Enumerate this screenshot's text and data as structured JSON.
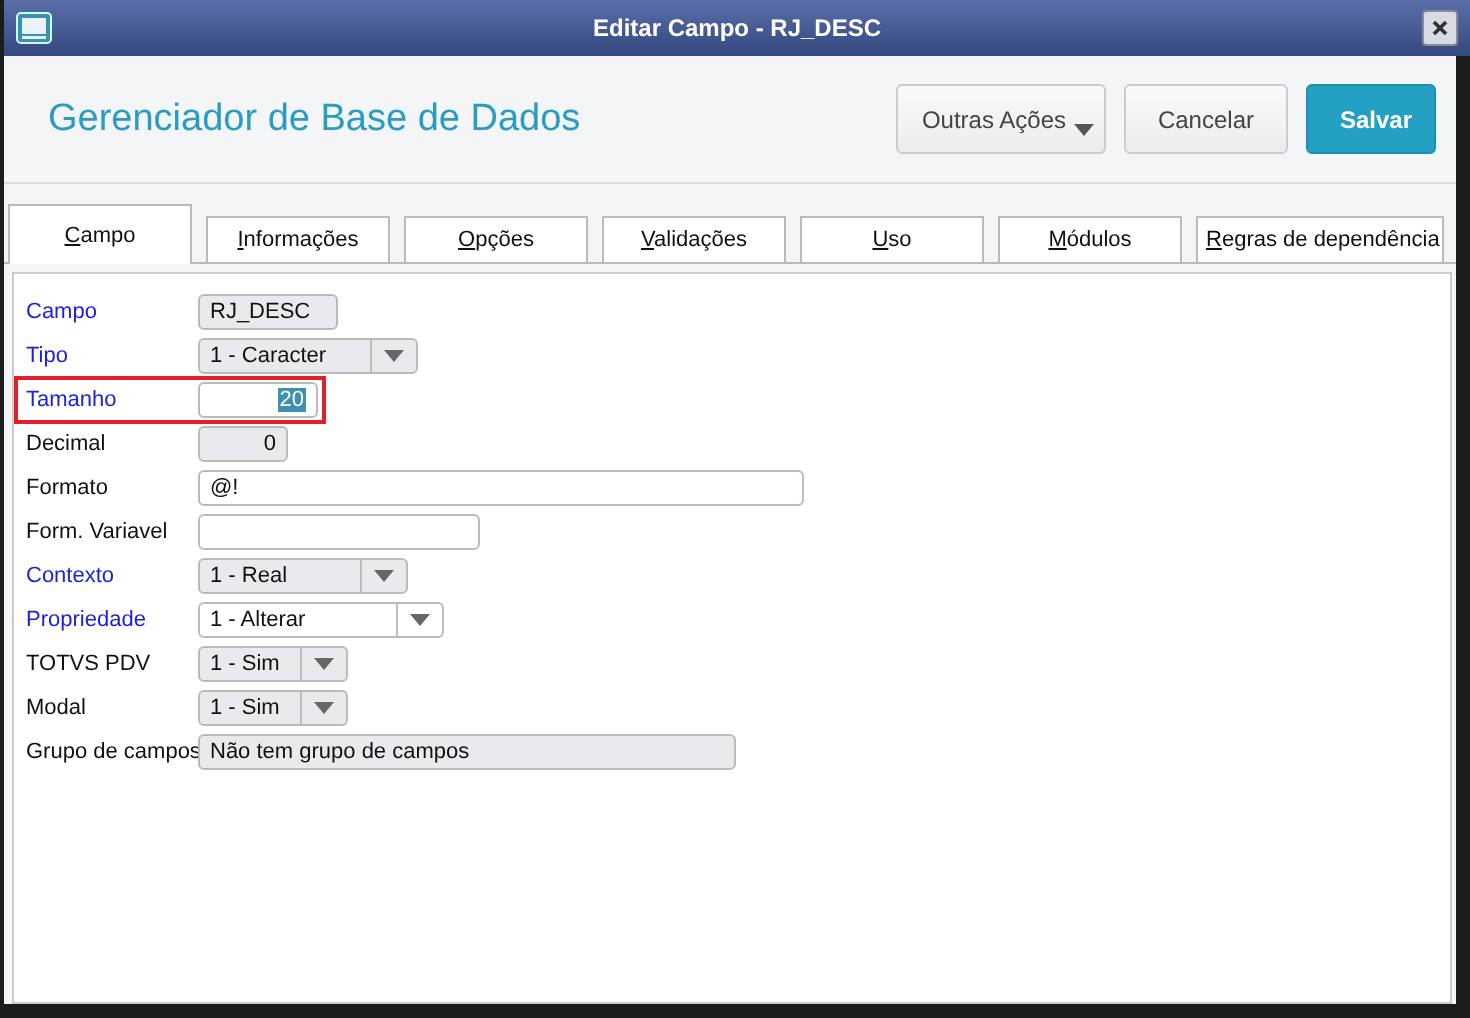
{
  "window": {
    "title": "Editar Campo - RJ_DESC"
  },
  "header": {
    "title": "Gerenciador de Base de Dados",
    "buttons": [
      {
        "label": "Outras Ações",
        "kind": "menu"
      },
      {
        "label": "Cancelar",
        "kind": "plain"
      },
      {
        "label": "Salvar",
        "kind": "primary"
      }
    ]
  },
  "tabs": [
    {
      "label": "Campo",
      "selected": true
    },
    {
      "label": "Informações",
      "selected": false
    },
    {
      "label": "Opções",
      "selected": false
    },
    {
      "label": "Validações",
      "selected": false
    },
    {
      "label": "Uso",
      "selected": false
    },
    {
      "label": "Módulos",
      "selected": false
    },
    {
      "label": "Regras de dependência",
      "selected": false
    }
  ],
  "fields": [
    {
      "label": "Campo",
      "value": "RJ_DESC",
      "kind": "text",
      "required": true,
      "disabled": true,
      "highlighted": false
    },
    {
      "label": "Tipo",
      "value": "1 - Caracter",
      "kind": "combo",
      "required": true,
      "disabled": true,
      "highlighted": false
    },
    {
      "label": "Tamanho",
      "value": "20",
      "kind": "number",
      "required": true,
      "disabled": false,
      "highlighted": true
    },
    {
      "label": "Decimal",
      "value": "0",
      "kind": "number",
      "required": false,
      "disabled": true,
      "highlighted": false
    },
    {
      "label": "Formato",
      "value": "@!",
      "kind": "text",
      "required": false,
      "disabled": false,
      "highlighted": false
    },
    {
      "label": "Form. Variavel",
      "kind": "text",
      "required": false,
      "disabled": false,
      "highlighted": false
    },
    {
      "label": "Contexto",
      "value": "1 - Real",
      "kind": "combo",
      "required": true,
      "disabled": true,
      "highlighted": false
    },
    {
      "label": "Propriedade",
      "value": "1 - Alterar",
      "kind": "combo",
      "required": true,
      "disabled": false,
      "highlighted": false
    },
    {
      "label": "TOTVS PDV",
      "value": "1 - Sim",
      "kind": "combo",
      "required": false,
      "disabled": true,
      "highlighted": false
    },
    {
      "label": "Modal",
      "value": "1 - Sim",
      "kind": "combo",
      "required": false,
      "disabled": true,
      "highlighted": false
    },
    {
      "label": "Grupo de campos",
      "value": "Não tem grupo de campos",
      "kind": "text",
      "required": false,
      "disabled": true,
      "highlighted": false
    }
  ]
}
